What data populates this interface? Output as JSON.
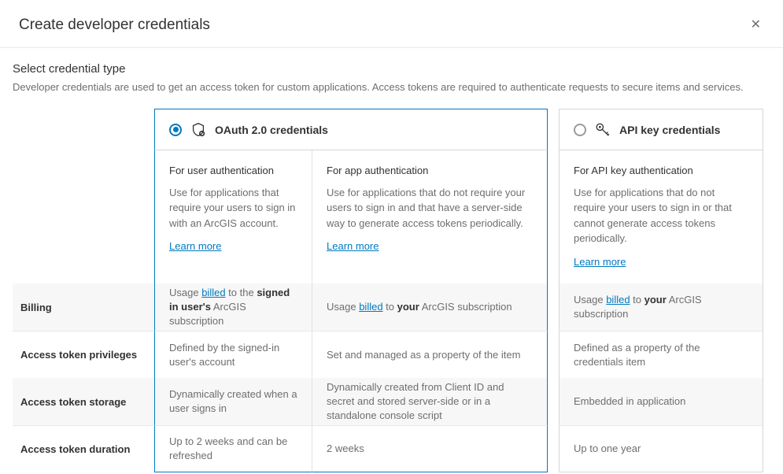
{
  "modal": {
    "title": "Create developer credentials",
    "close_symbol": "✕"
  },
  "section": {
    "title": "Select credential type",
    "description": "Developer credentials are used to get an access token for custom applications. Access tokens are required to authenticate requests to secure items and services."
  },
  "oauth": {
    "title": "OAuth 2.0 credentials",
    "selected": true,
    "user_auth": {
      "subtitle": "For user authentication",
      "text": "Use for applications that require your users to sign in with an ArcGIS account.",
      "learn": "Learn more"
    },
    "app_auth": {
      "subtitle": "For app authentication",
      "text": "Use for applications that do not require your users to sign in and that have a server-side way to generate access tokens periodically.",
      "learn": "Learn more"
    }
  },
  "apikey": {
    "title": "API key credentials",
    "selected": false,
    "desc": {
      "subtitle": "For API key authentication",
      "text": "Use for applications that do not require your users to sign in or that cannot generate access tokens periodically.",
      "learn": "Learn more"
    }
  },
  "rows": {
    "billing": {
      "label": "Billing",
      "oauth_user_prefix": "Usage ",
      "oauth_user_link": "billed",
      "oauth_user_mid": " to the ",
      "oauth_user_bold": "signed in user's",
      "oauth_user_suffix": " ArcGIS subscription",
      "oauth_app_prefix": "Usage ",
      "oauth_app_link": "billed",
      "oauth_app_mid": " to ",
      "oauth_app_bold": "your",
      "oauth_app_suffix": " ArcGIS subscription",
      "apikey_prefix": "Usage ",
      "apikey_link": "billed",
      "apikey_mid": " to ",
      "apikey_bold": "your",
      "apikey_suffix": " ArcGIS subscription"
    },
    "privileges": {
      "label": "Access token privileges",
      "oauth_user": "Defined by the signed-in user's account",
      "oauth_app": "Set and managed as a property of the item",
      "apikey": "Defined as a property of the credentials item"
    },
    "storage": {
      "label": "Access token storage",
      "oauth_user": "Dynamically created when a user signs in",
      "oauth_app": "Dynamically created from Client ID and secret and stored server-side or in a standalone console script",
      "apikey": "Embedded in application"
    },
    "duration": {
      "label": "Access token duration",
      "oauth_user": "Up to 2 weeks and can be refreshed",
      "oauth_app": "2 weeks",
      "apikey": "Up to one year"
    }
  }
}
